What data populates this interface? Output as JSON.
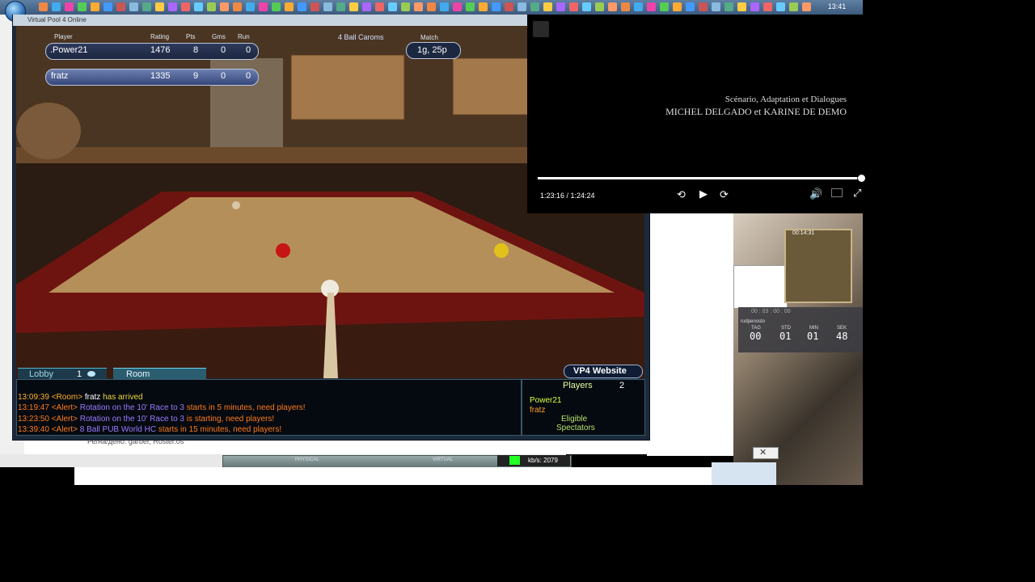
{
  "taskbar": {
    "clock": "13:41"
  },
  "vp4": {
    "window_title": "Virtual Pool 4 Online",
    "scoreboard": {
      "headers": {
        "player": "Player",
        "rating": "Rating",
        "pts": "Pts",
        "gms": "Gms",
        "run": "Run"
      },
      "rows": [
        {
          "player": ".Power21",
          "rating": "1476",
          "pts": "8",
          "gms": "0",
          "run": "0"
        },
        {
          "player": "fratz",
          "rating": "1335",
          "pts": "9",
          "gms": "0",
          "run": "0"
        }
      ],
      "mode": "4 Ball Caroms",
      "match_header": "Match",
      "match_value": "1g, 25p"
    },
    "tabs": {
      "lobby": "Lobby",
      "lobby_count": "1",
      "room": "Room"
    },
    "website_button": "VP4 Website",
    "chat": [
      {
        "time": "13:09:39",
        "tag": "<Room>",
        "name": "fratz",
        "msg": "has arrived"
      },
      {
        "time": "13:19:47",
        "tag": "<Alert>",
        "name": "Rotation on the 10' Race to 3",
        "msg": "starts in 5 minutes, need players!"
      },
      {
        "time": "13:23:50",
        "tag": "<Alert>",
        "name": "Rotation on the 10' Race to 3",
        "msg": "is starting, need players!"
      },
      {
        "time": "13:39:40",
        "tag": "<Alert>",
        "name": "8 Ball PUB World HC",
        "msg": "starts in 15 minutes, need players!"
      }
    ],
    "players_panel": {
      "title": "Players",
      "count": "2",
      "players": [
        "Power21",
        "fratz"
      ],
      "eligible": "Eligible",
      "spectators": "Spectators"
    }
  },
  "video": {
    "credits_line1": "Scénario, Adaptation et Dialogues",
    "credits_line2": "MICHEL DELGADO et KARINE DE DEMO",
    "time": "1:23:16 / 1:24:24",
    "progress": 0.9866
  },
  "browser": {
    "bottom_text": "Ре/на/дено: garber, Roster.os",
    "status": {
      "physical": "PHYSICAL",
      "virtual": "VIRTUAL",
      "kbps": "kb/s: 2079"
    }
  },
  "clock_widget": {
    "top_small": "00 : 03 : 00 : 00",
    "brand": "rudpenosto",
    "labels": [
      "TAG",
      "STD",
      "MIN",
      "SEK"
    ],
    "values": [
      "00",
      "01",
      "01",
      "48"
    ],
    "puzzle_timer": "00:14:31"
  },
  "colors": {
    "accent_teal": "#4fb6c8",
    "alert_orange": "#ff7a1a",
    "alert_purple": "#9a7aff"
  }
}
